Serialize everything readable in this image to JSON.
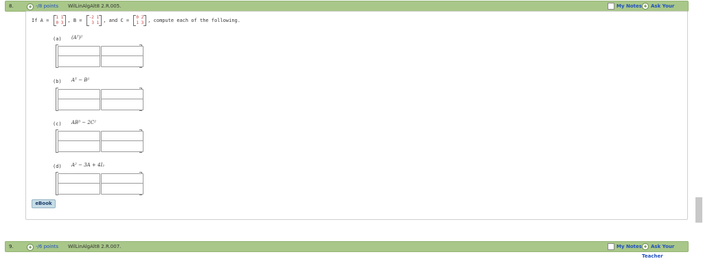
{
  "questions": [
    {
      "number": "8.",
      "points": "-/8 points",
      "code": "WilLinAlgAlt8 2.R.005.",
      "notes": "My Notes",
      "ask": "Ask Your Teacher"
    },
    {
      "number": "9.",
      "points": "-/6 points",
      "code": "WilLinAlgAlt8 2.R.007.",
      "notes": "My Notes",
      "ask": "Ask Your Teacher"
    }
  ],
  "problem": {
    "prefix": "If A =",
    "b_label": ", B =",
    "c_label": ", and C =",
    "suffix": ", compute each of the following.",
    "A": [
      [
        "1",
        "1"
      ],
      [
        "0",
        "3"
      ]
    ],
    "B": [
      [
        "-2",
        "1"
      ],
      [
        "3",
        "1"
      ]
    ],
    "C": [
      [
        "0",
        "2"
      ],
      [
        "1",
        "3"
      ]
    ]
  },
  "parts": [
    {
      "label": "(a)",
      "expr": "(Aᵀ)²"
    },
    {
      "label": "(b)",
      "expr": "Aᵀ − B²"
    },
    {
      "label": "(c)",
      "expr": "AB³ − 2C²"
    },
    {
      "label": "(d)",
      "expr": "A² − 3A + 4I₂"
    }
  ],
  "ebook_label": "eBook"
}
